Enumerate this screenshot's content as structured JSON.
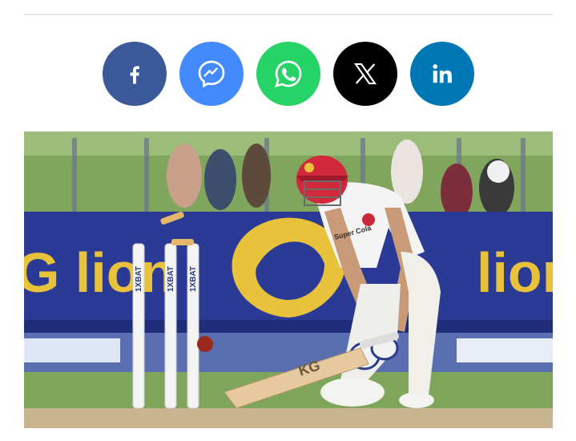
{
  "share": {
    "buttons": [
      {
        "id": "facebook",
        "icon": "facebook-icon",
        "color": "#3b5998"
      },
      {
        "id": "messenger",
        "icon": "messenger-icon",
        "color": "#448aff"
      },
      {
        "id": "whatsapp",
        "icon": "whatsapp-icon",
        "color": "#25d366"
      },
      {
        "id": "x",
        "icon": "x-icon",
        "color": "#000000"
      },
      {
        "id": "linkedin",
        "icon": "linkedin-icon",
        "color": "#0077b5"
      }
    ]
  },
  "photo": {
    "subject": "batter-bowled-stumps",
    "board_text_left": "G lion",
    "board_text_right": "lior",
    "stump_sponsor": "1XBAT",
    "jersey_text": "Super Cola",
    "bat_text": "KG",
    "colors": {
      "board": "#2b3b95",
      "board_text": "#e8c23a",
      "grass": "#7ea55a",
      "helmet": "#d2283c"
    }
  }
}
